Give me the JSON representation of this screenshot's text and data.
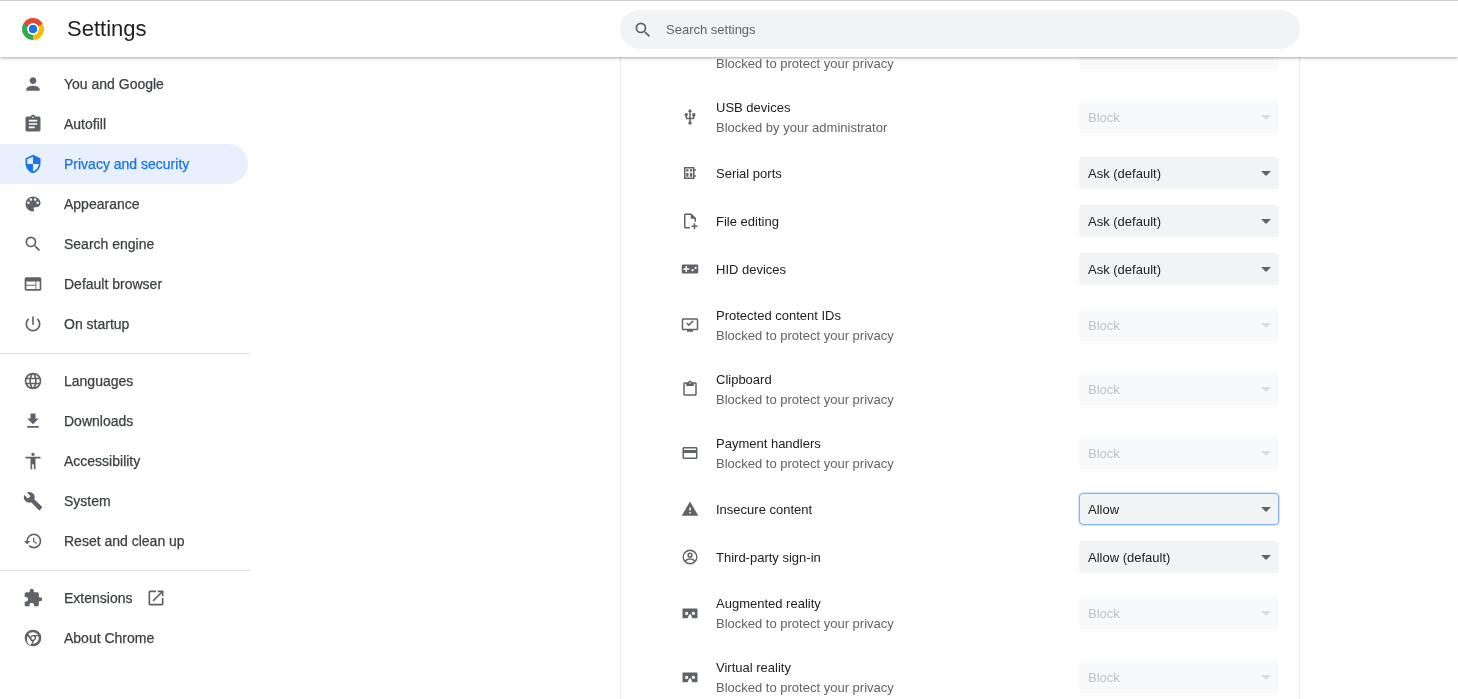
{
  "header": {
    "title": "Settings",
    "search": {
      "placeholder": "Search settings"
    }
  },
  "sidebar": {
    "sections": [
      {
        "items": [
          {
            "label": "You and Google",
            "selected": false,
            "kind": "page"
          },
          {
            "label": "Autofill",
            "selected": false,
            "kind": "page"
          },
          {
            "label": "Privacy and security",
            "selected": true,
            "kind": "page"
          },
          {
            "label": "Appearance",
            "selected": false,
            "kind": "page"
          },
          {
            "label": "Search engine",
            "selected": false,
            "kind": "page"
          },
          {
            "label": "Default browser",
            "selected": false,
            "kind": "page"
          },
          {
            "label": "On startup",
            "selected": false,
            "kind": "page"
          }
        ]
      },
      {
        "items": [
          {
            "label": "Languages",
            "selected": false,
            "kind": "page"
          },
          {
            "label": "Downloads",
            "selected": false,
            "kind": "page"
          },
          {
            "label": "Accessibility",
            "selected": false,
            "kind": "page"
          },
          {
            "label": "System",
            "selected": false,
            "kind": "page"
          },
          {
            "label": "Reset and clean up",
            "selected": false,
            "kind": "page"
          }
        ]
      },
      {
        "items": [
          {
            "label": "Extensions",
            "selected": false,
            "kind": "external"
          },
          {
            "label": "About Chrome",
            "selected": false,
            "kind": "page"
          }
        ]
      }
    ]
  },
  "rows": [
    {
      "subtitle": "Blocked to protect your privacy"
    },
    {
      "title": "USB devices",
      "subtitle": "Blocked by your administrator",
      "value": "Block",
      "disabled": true,
      "focused": false
    },
    {
      "title": "Serial ports",
      "value": "Ask (default)",
      "disabled": false,
      "focused": false
    },
    {
      "title": "File editing",
      "value": "Ask (default)",
      "disabled": false,
      "focused": false
    },
    {
      "title": "HID devices",
      "value": "Ask (default)",
      "disabled": false,
      "focused": false
    },
    {
      "title": "Protected content IDs",
      "subtitle": "Blocked to protect your privacy",
      "value": "Block",
      "disabled": true,
      "focused": false
    },
    {
      "title": "Clipboard",
      "subtitle": "Blocked to protect your privacy",
      "value": "Block",
      "disabled": true,
      "focused": false
    },
    {
      "title": "Payment handlers",
      "subtitle": "Blocked to protect your privacy",
      "value": "Block",
      "disabled": true,
      "focused": false
    },
    {
      "title": "Insecure content",
      "value": "Allow",
      "disabled": false,
      "focused": true
    },
    {
      "title": "Third-party sign-in",
      "value": "Allow (default)",
      "disabled": false,
      "focused": false
    },
    {
      "title": "Augmented reality",
      "subtitle": "Blocked to protect your privacy",
      "value": "Block",
      "disabled": true,
      "focused": false
    },
    {
      "title": "Virtual reality",
      "subtitle": "Blocked to protect your privacy",
      "value": "Block",
      "disabled": true,
      "focused": false
    }
  ]
}
